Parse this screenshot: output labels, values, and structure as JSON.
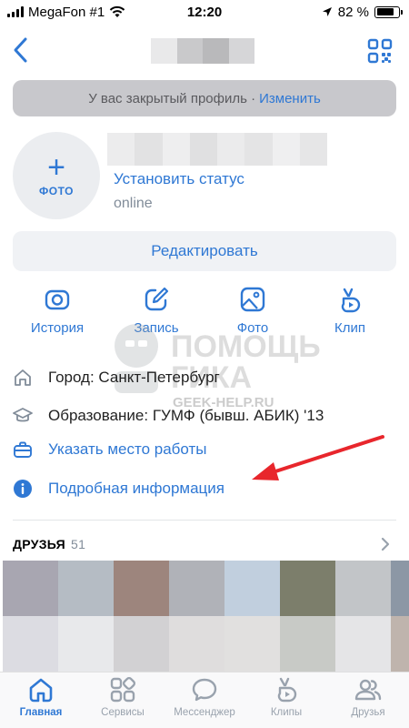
{
  "status_bar": {
    "carrier": "MegaFon #1",
    "time": "12:20",
    "battery": "82 %",
    "battery_level": 0.82
  },
  "banner": {
    "text": "У вас закрытый профиль ·",
    "link": "Изменить"
  },
  "avatar": {
    "label": "ФОТО"
  },
  "profile": {
    "set_status": "Установить статус",
    "online": "online"
  },
  "edit_button": "Редактировать",
  "actions": [
    {
      "label": "История",
      "icon": "camera-icon"
    },
    {
      "label": "Запись",
      "icon": "pencil-square-icon"
    },
    {
      "label": "Фото",
      "icon": "image-icon"
    },
    {
      "label": "Клип",
      "icon": "clip-icon"
    }
  ],
  "info": {
    "city": "Город: Санкт-Петербург",
    "education": "Образование: ГУМФ (бывш. АБИК) '13",
    "work": "Указать место работы",
    "details": "Подробная информация"
  },
  "watermark": {
    "line1": "ПОМОЩЬ",
    "line2": "ГИКА",
    "url": "GEEK-HELP.RU"
  },
  "friends": {
    "title": "ДРУЗЬЯ",
    "count": "51"
  },
  "tabbar": [
    {
      "label": "Главная",
      "icon": "home-icon",
      "active": true
    },
    {
      "label": "Сервисы",
      "icon": "services-icon",
      "active": false
    },
    {
      "label": "Мессенджер",
      "icon": "messenger-icon",
      "active": false
    },
    {
      "label": "Клипы",
      "icon": "clips-icon",
      "active": false
    },
    {
      "label": "Друзья",
      "icon": "friends-icon",
      "active": false
    }
  ],
  "colors": {
    "accent": "#2f78d4",
    "arrow": "#e8262c",
    "muted": "#818c99"
  }
}
